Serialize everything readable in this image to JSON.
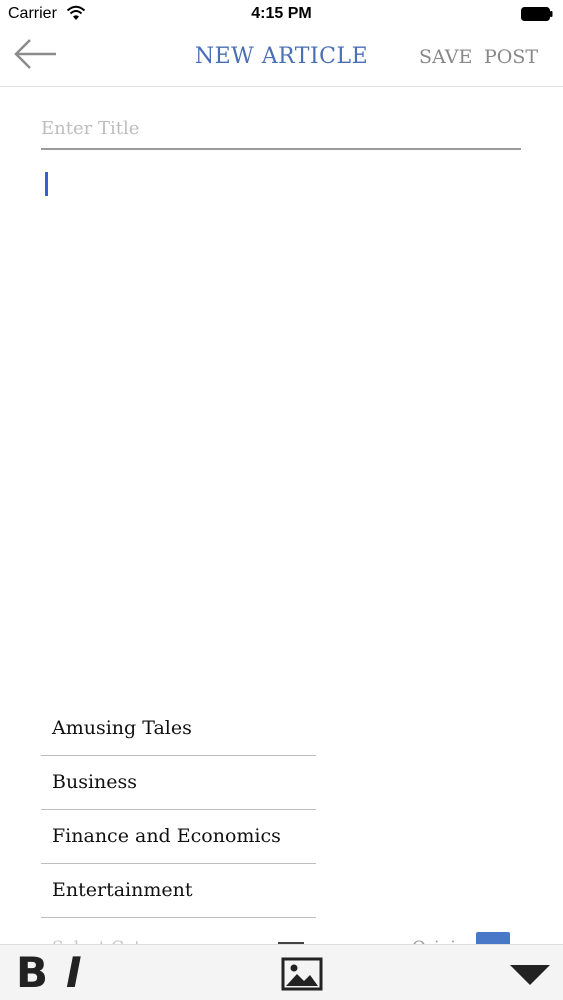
{
  "status_bar": {
    "carrier": "Carrier",
    "time": "4:15 PM"
  },
  "nav": {
    "title": "NEW ARTICLE",
    "save_label": "SAVE",
    "post_label": "POST"
  },
  "editor": {
    "title_placeholder": "Enter Title"
  },
  "categories": {
    "items": [
      "Amusing Tales",
      "Business",
      "Finance and Economics",
      "Entertainment"
    ]
  },
  "bottom_row": {
    "select_label": "Select Cat",
    "original_label": "Original"
  },
  "toolbar": {
    "bold_label": "B",
    "italic_label": "I"
  },
  "colors": {
    "accent": "#4a6fb5",
    "cursor": "#3d5fc9"
  }
}
